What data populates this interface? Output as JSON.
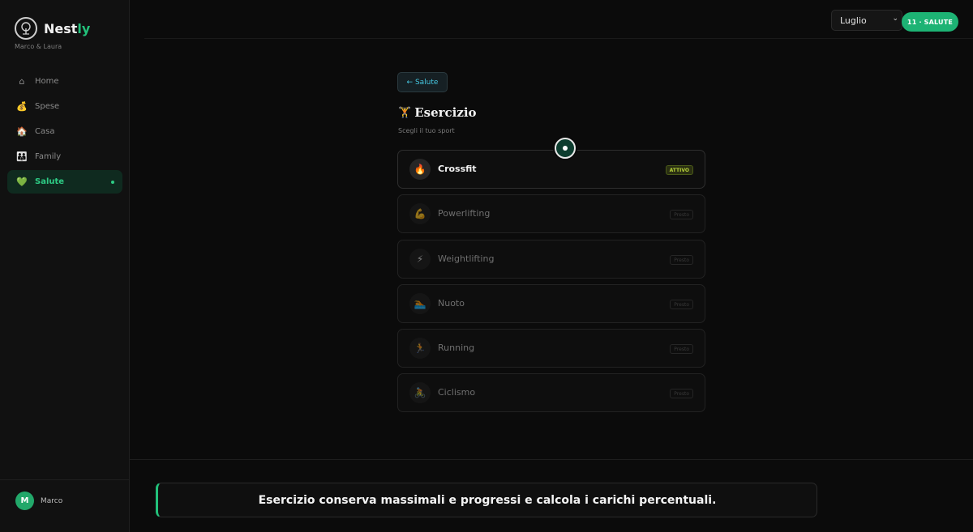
{
  "app": {
    "brand_prefix": "Nest",
    "brand_accent": "ly",
    "subtitle": "Marco & Laura",
    "accent_color": "#22c07a"
  },
  "sidebar": {
    "items": [
      {
        "label": "Home",
        "icon": "home-icon",
        "glyph": "⌂"
      },
      {
        "label": "Spese",
        "icon": "money-bag-icon",
        "glyph": "💰"
      },
      {
        "label": "Casa",
        "icon": "house-icon",
        "glyph": "🏠"
      },
      {
        "label": "Family",
        "icon": "family-icon",
        "glyph": "👪"
      },
      {
        "label": "Salute",
        "icon": "green-heart-icon",
        "glyph": "💚",
        "active": true
      }
    ],
    "user": {
      "initial": "M",
      "name": "Marco"
    }
  },
  "topbar": {
    "month_selected": "Luglio",
    "section_pill": "11 · SALUTE"
  },
  "main": {
    "back_label": "← Salute",
    "title_icon": "🏋",
    "title": "Esercizio",
    "subtitle": "Scegli il tuo sport",
    "sports": [
      {
        "name": "Crossfit",
        "icon": "fire-icon",
        "glyph": "🔥",
        "badge": "ATTIVO",
        "active": true
      },
      {
        "name": "Powerlifting",
        "icon": "flexed-biceps-icon",
        "glyph": "💪",
        "badge": "Presto"
      },
      {
        "name": "Weightlifting",
        "icon": "lightning-icon",
        "glyph": "⚡",
        "badge": "Presto"
      },
      {
        "name": "Nuoto",
        "icon": "swimmer-icon",
        "glyph": "🏊",
        "badge": "Presto"
      },
      {
        "name": "Running",
        "icon": "runner-icon",
        "glyph": "🏃",
        "badge": "Presto"
      },
      {
        "name": "Ciclismo",
        "icon": "cyclist-icon",
        "glyph": "🚴",
        "badge": "Presto"
      }
    ]
  },
  "caption": "Esercizio conserva massimali e progressi e calcola i carichi percentuali."
}
